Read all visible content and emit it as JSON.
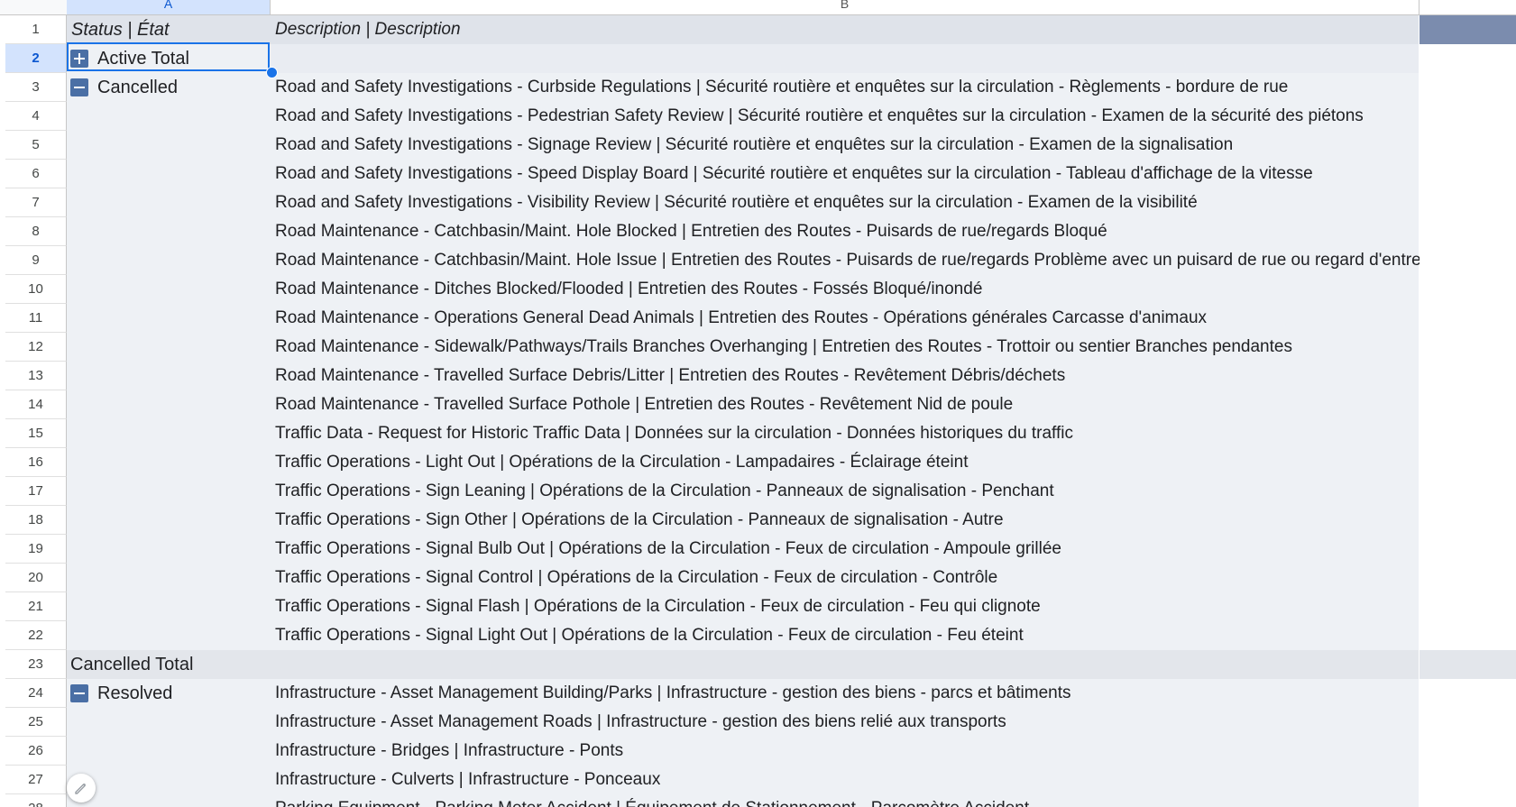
{
  "columns": {
    "a": "A",
    "b": "B"
  },
  "rows": [
    {
      "num": "1",
      "status": "Status | État",
      "toggle": "none",
      "description": "Description | Description"
    },
    {
      "num": "2",
      "status": "Active Total",
      "toggle": "plus",
      "description": ""
    },
    {
      "num": "3",
      "status": "Cancelled",
      "toggle": "minus",
      "description": "Road and Safety Investigations - Curbside Regulations | Sécurité routière et enquêtes sur la circulation - Règlements - bordure de rue"
    },
    {
      "num": "4",
      "status": "",
      "toggle": "none",
      "description": "Road and Safety Investigations - Pedestrian Safety Review | Sécurité routière et enquêtes sur la circulation - Examen de la sécurité des piétons"
    },
    {
      "num": "5",
      "status": "",
      "toggle": "none",
      "description": "Road and Safety Investigations - Signage Review | Sécurité routière et enquêtes sur la circulation - Examen de la signalisation"
    },
    {
      "num": "6",
      "status": "",
      "toggle": "none",
      "description": "Road and Safety Investigations - Speed Display Board | Sécurité routière et enquêtes sur la circulation - Tableau d'affichage de la vitesse"
    },
    {
      "num": "7",
      "status": "",
      "toggle": "none",
      "description": "Road and Safety Investigations - Visibility Review | Sécurité routière et enquêtes sur la circulation - Examen de la visibilité"
    },
    {
      "num": "8",
      "status": "",
      "toggle": "none",
      "description": "Road Maintenance - Catchbasin/Maint. Hole Blocked | Entretien des Routes - Puisards de rue/regards Bloqué"
    },
    {
      "num": "9",
      "status": "",
      "toggle": "none",
      "description": "Road Maintenance - Catchbasin/Maint. Hole Issue | Entretien des Routes - Puisards de rue/regards Problème avec un puisard de rue ou regard d'entretien"
    },
    {
      "num": "10",
      "status": "",
      "toggle": "none",
      "description": "Road Maintenance - Ditches Blocked/Flooded | Entretien des Routes - Fossés Bloqué/inondé"
    },
    {
      "num": "11",
      "status": "",
      "toggle": "none",
      "description": "Road Maintenance - Operations General Dead Animals | Entretien des Routes - Opérations générales Carcasse d'animaux"
    },
    {
      "num": "12",
      "status": "",
      "toggle": "none",
      "description": "Road Maintenance - Sidewalk/Pathways/Trails Branches Overhanging | Entretien des Routes - Trottoir ou sentier Branches pendantes"
    },
    {
      "num": "13",
      "status": "",
      "toggle": "none",
      "description": "Road Maintenance - Travelled Surface Debris/Litter | Entretien des Routes - Revêtement Débris/déchets"
    },
    {
      "num": "14",
      "status": "",
      "toggle": "none",
      "description": "Road Maintenance - Travelled Surface Pothole | Entretien des Routes - Revêtement Nid de poule"
    },
    {
      "num": "15",
      "status": "",
      "toggle": "none",
      "description": "Traffic Data - Request for Historic Traffic Data | Données sur la circulation - Données historiques du traffic"
    },
    {
      "num": "16",
      "status": "",
      "toggle": "none",
      "description": "Traffic Operations - Light Out | Opérations de la Circulation - Lampadaires - Éclairage éteint"
    },
    {
      "num": "17",
      "status": "",
      "toggle": "none",
      "description": "Traffic Operations - Sign Leaning | Opérations de la Circulation - Panneaux de signalisation - Penchant"
    },
    {
      "num": "18",
      "status": "",
      "toggle": "none",
      "description": "Traffic Operations - Sign Other | Opérations de la Circulation - Panneaux de signalisation - Autre"
    },
    {
      "num": "19",
      "status": "",
      "toggle": "none",
      "description": "Traffic Operations - Signal Bulb Out | Opérations de la Circulation - Feux de circulation - Ampoule grillée"
    },
    {
      "num": "20",
      "status": "",
      "toggle": "none",
      "description": "Traffic Operations - Signal Control | Opérations de la Circulation - Feux de circulation - Contrôle"
    },
    {
      "num": "21",
      "status": "",
      "toggle": "none",
      "description": "Traffic Operations - Signal Flash | Opérations de la Circulation - Feux de circulation - Feu qui clignote"
    },
    {
      "num": "22",
      "status": "",
      "toggle": "none",
      "description": "Traffic Operations - Signal Light Out | Opérations de la Circulation - Feux de circulation - Feu éteint"
    },
    {
      "num": "23",
      "status": "Cancelled Total",
      "toggle": "none",
      "description": ""
    },
    {
      "num": "24",
      "status": "Resolved",
      "toggle": "minus",
      "description": "Infrastructure - Asset Management Building/Parks | Infrastructure - gestion des biens - parcs et bâtiments"
    },
    {
      "num": "25",
      "status": "",
      "toggle": "none",
      "description": "Infrastructure - Asset Management Roads | Infrastructure - gestion des biens relié aux transports"
    },
    {
      "num": "26",
      "status": "",
      "toggle": "none",
      "description": "Infrastructure - Bridges | Infrastructure - Ponts"
    },
    {
      "num": "27",
      "status": "",
      "toggle": "none",
      "description": "Infrastructure - Culverts | Infrastructure - Ponceaux"
    },
    {
      "num": "28",
      "status": "",
      "toggle": "none",
      "description": "Parking Equipment - Parking Meter Accident | Équipement de Stationnement - Parcomètre Accident"
    }
  ],
  "selection": {
    "row": "2",
    "column": "A"
  },
  "icons": {
    "expand": "plus-box-icon",
    "collapse": "minus-box-icon",
    "edit": "pencil-icon"
  },
  "colors": {
    "accent": "#1a73e8",
    "toggle": "#4a6fa5",
    "header_fill": "#dfe3ea",
    "band_fill": "#7b8cae"
  }
}
